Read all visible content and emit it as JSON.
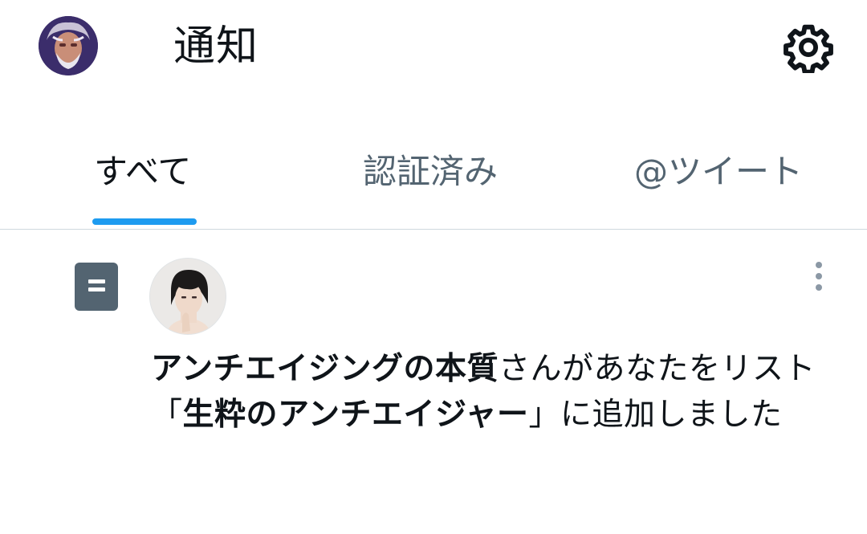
{
  "header": {
    "title": "通知",
    "avatar_icon": "user-avatar",
    "settings_icon": "gear-icon"
  },
  "tabs": [
    {
      "label": "すべて",
      "active": true
    },
    {
      "label": "認証済み",
      "active": false
    },
    {
      "label": "@ツイート",
      "active": false
    }
  ],
  "notification": {
    "type_icon": "list-icon",
    "more_icon": "more-vertical-icon",
    "actor_name": "アンチエイジングの本質",
    "text_1": "さんがあなたをリスト「",
    "list_name": "生粋のアンチエイジャー",
    "text_2": "」に追加しました"
  },
  "colors": {
    "accent": "#1d9bf0",
    "text_primary": "#0f1419",
    "text_secondary": "#536471",
    "divider": "#cfd9de"
  }
}
